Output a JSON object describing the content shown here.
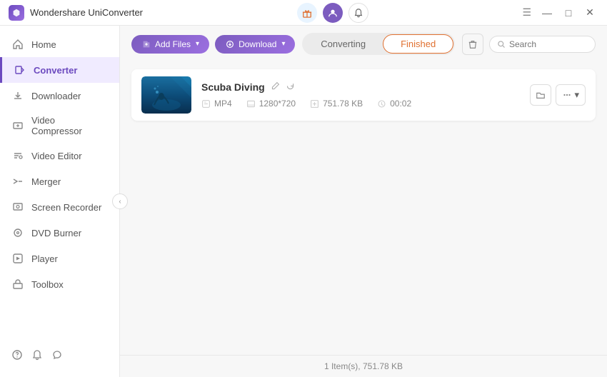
{
  "app": {
    "title": "Wondershare UniConverter"
  },
  "title_bar": {
    "buttons": {
      "minimize": "—",
      "maximize": "□",
      "close": "✕"
    }
  },
  "sidebar": {
    "items": [
      {
        "id": "home",
        "label": "Home",
        "icon": "home"
      },
      {
        "id": "converter",
        "label": "Converter",
        "icon": "converter",
        "active": true
      },
      {
        "id": "downloader",
        "label": "Downloader",
        "icon": "downloader"
      },
      {
        "id": "video-compressor",
        "label": "Video Compressor",
        "icon": "compress"
      },
      {
        "id": "video-editor",
        "label": "Video Editor",
        "icon": "edit"
      },
      {
        "id": "merger",
        "label": "Merger",
        "icon": "merge"
      },
      {
        "id": "screen-recorder",
        "label": "Screen Recorder",
        "icon": "record"
      },
      {
        "id": "dvd-burner",
        "label": "DVD Burner",
        "icon": "dvd"
      },
      {
        "id": "player",
        "label": "Player",
        "icon": "play"
      },
      {
        "id": "toolbox",
        "label": "Toolbox",
        "icon": "toolbox"
      }
    ],
    "footer": {
      "help": "?",
      "notification": "🔔",
      "feedback": "↺"
    }
  },
  "toolbar": {
    "add_file_label": "Add Files",
    "add_file_arrow": "▾",
    "download_label": "Download",
    "download_arrow": "▾"
  },
  "tabs": {
    "converting_label": "Converting",
    "finished_label": "Finished"
  },
  "search": {
    "placeholder": "Search"
  },
  "files": [
    {
      "name": "Scuba Diving",
      "format": "MP4",
      "resolution": "1280*720",
      "size": "751.78 KB",
      "duration": "00:02"
    }
  ],
  "status_bar": {
    "text": "1 Item(s), 751.78 KB"
  }
}
